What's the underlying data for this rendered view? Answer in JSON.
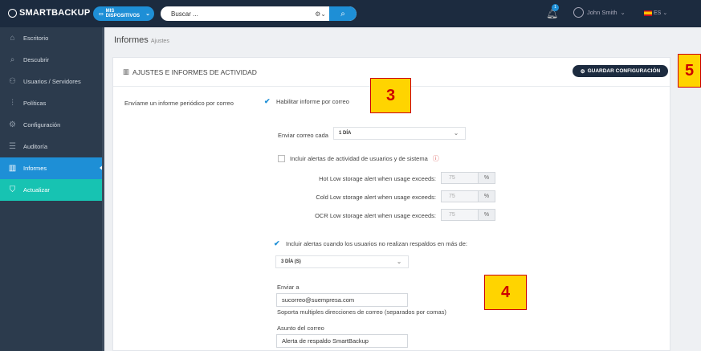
{
  "topbar": {
    "logo": "SMARTBACKUP",
    "devices_label": "MIS DISPOSITIVOS",
    "search_placeholder": "Buscar ...",
    "notification_count": "1",
    "user_name": "John Smith",
    "language": "ES"
  },
  "sidebar": {
    "items": [
      {
        "label": "Escritorio",
        "icon": "home-icon"
      },
      {
        "label": "Descubrir",
        "icon": "search-icon"
      },
      {
        "label": "Usuarios / Servidores",
        "icon": "users-icon"
      },
      {
        "label": "Políticas",
        "icon": "sliders-icon"
      },
      {
        "label": "Configuración",
        "icon": "gear-icon"
      },
      {
        "label": "Auditoría",
        "icon": "list-icon"
      },
      {
        "label": "Informes",
        "icon": "bar-chart-icon"
      },
      {
        "label": "Actualizar",
        "icon": "cart-icon"
      }
    ]
  },
  "breadcrumb": {
    "title": "Informes",
    "sub": "Ajustes"
  },
  "panel": {
    "title": "AJUSTES E INFORMES DE ACTIVIDAD",
    "save_label": "GUARDAR CONFIGURACIÓN",
    "left_label": "Envíame un informe periódico por correo",
    "enable_label": "Habilitar informe por correo",
    "send_every_label": "Enviar correo cada",
    "send_every_value": "1 DÍA",
    "include_activity_label": "Incluir alertas de actividad de usuarios y de sistema",
    "alerts": [
      {
        "label": "Hot Low storage alert when usage exceeds:",
        "value": "75",
        "unit": "%"
      },
      {
        "label": "Cold Low storage alert when usage exceeds:",
        "value": "75",
        "unit": "%"
      },
      {
        "label": "OCR Low storage alert when usage exceeds:",
        "value": "75",
        "unit": "%"
      }
    ],
    "no_backup_label": "Incluir alertas cuando los usuarios no realizan respaldos en más de:",
    "no_backup_value": "3 DÍA (S)",
    "send_to_label": "Enviar a",
    "send_to_value": "sucorreo@suempresa.com",
    "send_to_help": "Soporta multiples direcciones de correo (separados por comas)",
    "subject_label": "Asunto del correo",
    "subject_value": "Alerta de respaldo SmartBackup"
  },
  "annotations": [
    "3",
    "4",
    "5"
  ],
  "colors": {
    "accent": "#1e8fd6",
    "topbar": "#1c2b3f",
    "sidebar": "#2c3b4d",
    "update": "#17c3b2",
    "annotation": "#ffd400"
  }
}
